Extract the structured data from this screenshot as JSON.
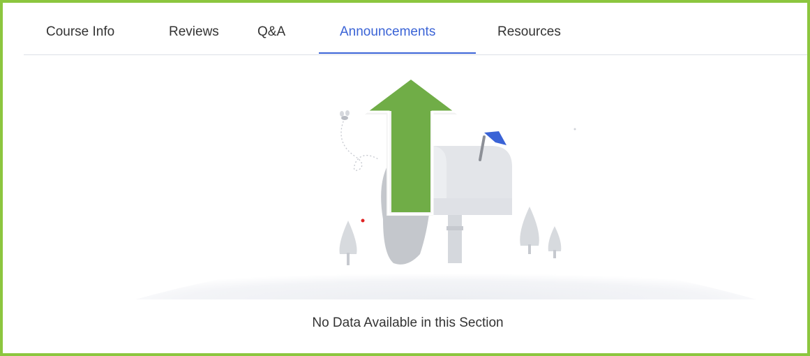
{
  "tabs": [
    {
      "label": "Course Info",
      "active": false
    },
    {
      "label": "Reviews",
      "active": false
    },
    {
      "label": "Q&A",
      "active": false
    },
    {
      "label": "Announcements",
      "active": true
    },
    {
      "label": "Resources",
      "active": false
    }
  ],
  "empty_state": {
    "message": "No Data Available in this Section",
    "illustration": "mailbox-illustration"
  },
  "annotation": {
    "arrow_icon": "arrow-up-icon",
    "arrow_color": "#70ad47"
  },
  "colors": {
    "frame_border": "#8cc63f",
    "active_tab": "#3a63d6",
    "flag": "#3a63d6"
  }
}
